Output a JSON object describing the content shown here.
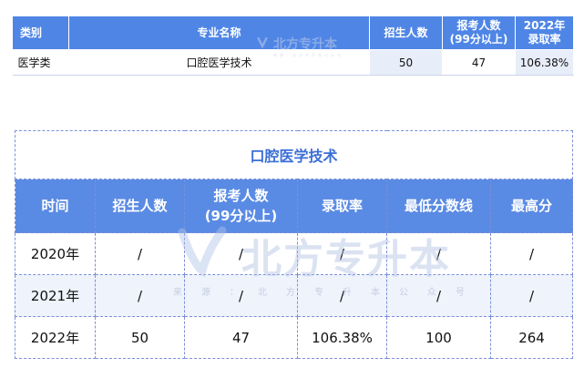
{
  "summary_table": {
    "headers": [
      "类别",
      "专业名称",
      "招生人数",
      "报考人数\n(99分以上)",
      "2022年\n录取率"
    ],
    "header_col4_line1": "报考人数",
    "header_col4_line2": "(99分以上)",
    "header_col5_line1": "2022年",
    "header_col5_line2": "录取率",
    "row": {
      "category": "医学类",
      "major": "口腔医学技术",
      "enrollment": "50",
      "applicants": "47",
      "admission_rate": "106.38%"
    }
  },
  "detail_table": {
    "title": "口腔医学技术",
    "headers": {
      "time": "时间",
      "enrollment": "招生人数",
      "applicants_line1": "报考人数",
      "applicants_line2": "(99分以上)",
      "admission_rate": "录取率",
      "min_score": "最低分数线",
      "max_score": "最高分"
    },
    "rows": [
      {
        "year": "2020年",
        "enrollment": "/",
        "applicants": "/",
        "admission_rate": "/",
        "min_score": "/",
        "max_score": "/"
      },
      {
        "year": "2021年",
        "enrollment": "/",
        "applicants": "/",
        "admission_rate": "/",
        "min_score": "/",
        "max_score": "/"
      },
      {
        "year": "2022年",
        "enrollment": "50",
        "applicants": "47",
        "admission_rate": "106.38%",
        "min_score": "100",
        "max_score": "264"
      }
    ]
  },
  "watermark": {
    "brand": "北方专升本",
    "source_line": "来源：北方专升本公众号"
  },
  "colors": {
    "header_blue": "#4f86e6",
    "detail_header_blue": "#5a8be4",
    "title_blue": "#3b6fd8",
    "row_shade": "#eef3fc",
    "dashed_border": "#7c8fd8"
  }
}
